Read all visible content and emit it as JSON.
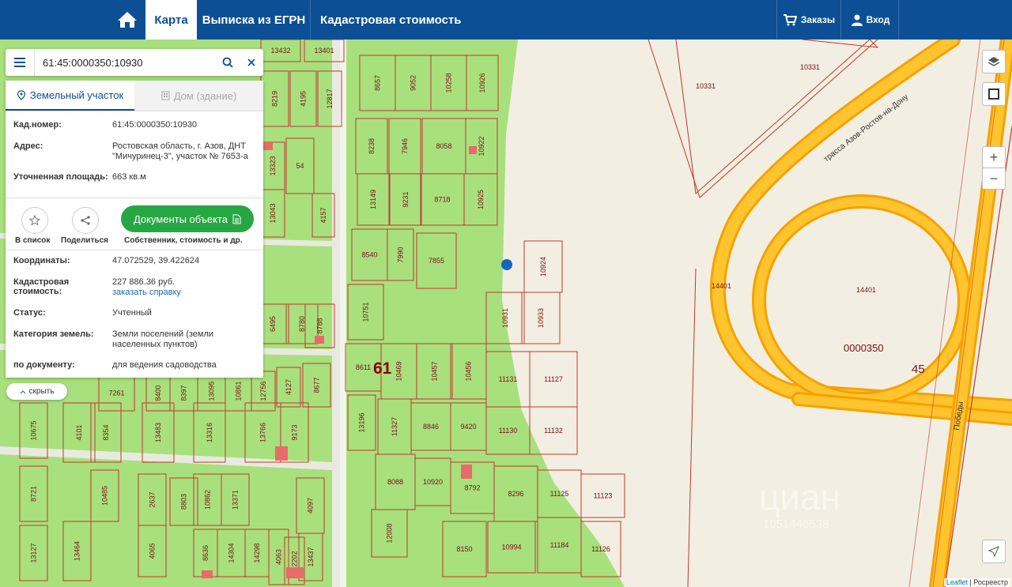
{
  "topbar": {
    "home_icon": "home-icon",
    "nav": [
      "Карта",
      "Выписка из ЕГРН",
      "Кадастровая стоимость"
    ],
    "orders_label": "Заказы",
    "login_label": "Вход",
    "colors": {
      "bar": "#0c4f95",
      "active_bg": "#ffffff"
    }
  },
  "search": {
    "value": "61:45:0000350:10930"
  },
  "card": {
    "tab_land": "Земельный участок",
    "tab_house": "Дом (здание)",
    "kad_label": "Кад.номер:",
    "kad_value": "61:45:0000350:10930",
    "addr_label": "Адрес:",
    "addr_value": "Ростовская область, г. Азов, ДНТ \"Мичуринец-3\", участок № 7653-а",
    "area_label": "Уточненная площадь:",
    "area_value": "663 кв.м",
    "fav_label": "В список",
    "share_label": "Поделиться",
    "doc_button": "Документы объекта",
    "doc_sub": "Собственник, стоимость и др.",
    "coords_label": "Координаты:",
    "coords_value": "47.072529, 39.422624",
    "cost_label": "Кадастровая стоимость:",
    "cost_value": "227 886.36 руб.",
    "cost_link": "заказать справку",
    "status_label": "Статус:",
    "status_value": "Учтенный",
    "cat_label": "Категория земель:",
    "cat_value": "Земли поселений (земли населенных пунктов)",
    "doc_label": "по документу:",
    "doc_value": "для ведения садоводства",
    "accent": "#27a744"
  },
  "hide_label": "скрыть",
  "map": {
    "road_name": "трасса Азов-Ростов-на-Дону",
    "street_name": "Победы",
    "quarter_numbers": [
      "10331",
      "10331",
      "14401",
      "14401",
      "0000350",
      "45",
      "61"
    ],
    "parcels": [
      "13432",
      "13401",
      "8657",
      "9052",
      "10258",
      "10926",
      "8219",
      "4195",
      "12817",
      "8238",
      "7946",
      "8058",
      "10922",
      "13323",
      "54",
      "13149",
      "9231",
      "8718",
      "10925",
      "13043",
      "4157",
      "8540",
      "7990",
      "7855",
      "10924",
      "10751",
      "10931",
      "10933",
      "6495",
      "8780",
      "8788",
      "8611",
      "10469",
      "10457",
      "10456",
      "11131",
      "11127",
      "7261",
      "8400",
      "8397",
      "13095",
      "10861",
      "12756",
      "4127",
      "8677",
      "13196",
      "11327",
      "8846",
      "9420",
      "11130",
      "11132",
      "10675",
      "4101",
      "8354",
      "13483",
      "13316",
      "13766",
      "9173",
      "8088",
      "10920",
      "8792",
      "8296",
      "11125",
      "11123",
      "8721",
      "10485",
      "2637",
      "8803",
      "10862",
      "13371",
      "4097",
      "12008",
      "8150",
      "10994",
      "11184",
      "11126",
      "13127",
      "13464",
      "4065",
      "8636",
      "14304",
      "14298",
      "4063",
      "12202",
      "13437"
    ],
    "watermark": "циан",
    "watermark_sub": "1051446538"
  },
  "controls": {
    "zoom_in": "+",
    "zoom_out": "−"
  },
  "attribution": {
    "leaflet": "Leaflet",
    "sep": " | ",
    "source": "Росреестр"
  }
}
